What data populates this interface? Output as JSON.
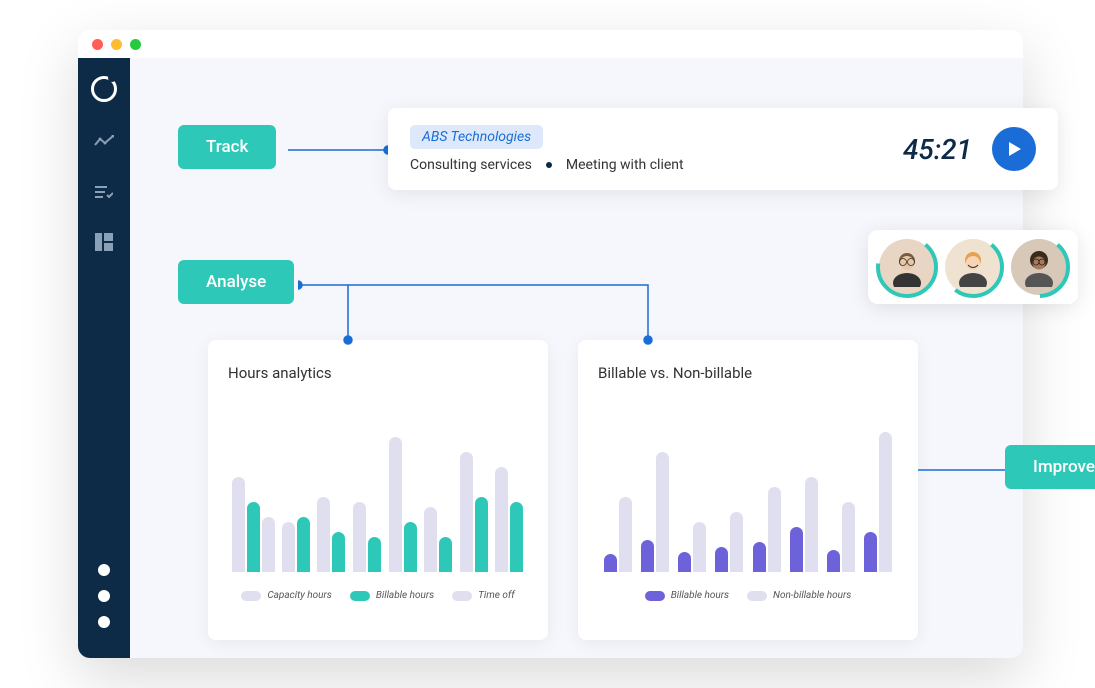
{
  "badges": {
    "track": "Track",
    "analyse": "Analyse",
    "improve": "Improve"
  },
  "tracker": {
    "client": "ABS Technologies",
    "service": "Consulting services",
    "task": "Meeting with client",
    "time": "45:21"
  },
  "charts": {
    "hours": {
      "title": "Hours analytics",
      "legend": {
        "capacity": "Capacity hours",
        "billable": "Billable hours",
        "timeoff": "Time off"
      }
    },
    "billable": {
      "title": "Billable vs. Non-billable",
      "legend": {
        "billable": "Billable hours",
        "nonbillable": "Non-billable hours"
      }
    }
  },
  "chart_data": [
    {
      "type": "bar",
      "title": "Hours analytics",
      "series": [
        {
          "name": "Capacity hours",
          "values": [
            95,
            50,
            75,
            70,
            135,
            65,
            120,
            105
          ]
        },
        {
          "name": "Billable hours",
          "values": [
            70,
            55,
            40,
            35,
            50,
            35,
            75,
            70
          ]
        },
        {
          "name": "Time off",
          "values": [
            55,
            0,
            0,
            0,
            0,
            0,
            0,
            0
          ]
        }
      ],
      "ylim": [
        0,
        160
      ]
    },
    {
      "type": "bar",
      "title": "Billable vs. Non-billable",
      "series": [
        {
          "name": "Billable hours",
          "values": [
            18,
            32,
            20,
            25,
            30,
            45,
            22,
            40
          ]
        },
        {
          "name": "Non-billable hours",
          "values": [
            75,
            120,
            50,
            60,
            85,
            95,
            70,
            140
          ]
        }
      ],
      "ylim": [
        0,
        160
      ]
    }
  ],
  "colors": {
    "teal": "#2ec8b8",
    "purple": "#6d62d9",
    "blue": "#1a6dd6",
    "sidebar": "#0d2a47"
  }
}
